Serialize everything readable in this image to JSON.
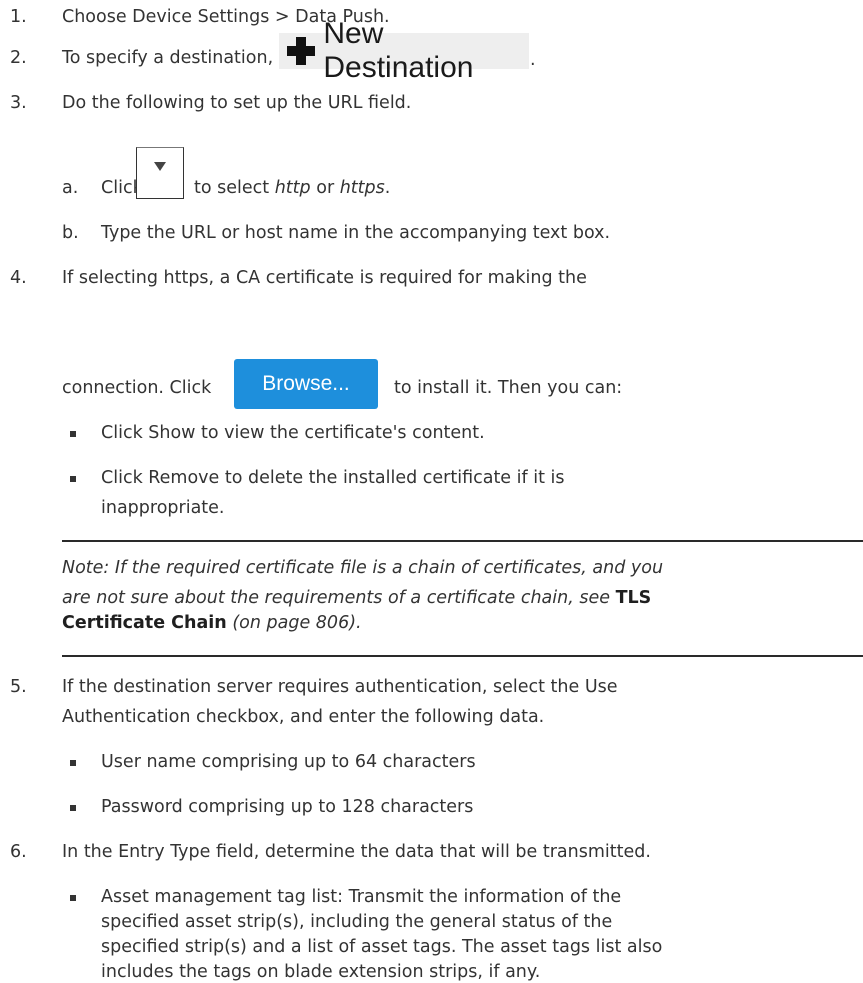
{
  "steps": {
    "s1": {
      "num": "1.",
      "text": "Choose Device Settings > Data Push."
    },
    "s2": {
      "num": "2.",
      "text": "To specify a destination, click",
      "button": "New Destination",
      "suffix": "."
    },
    "s3": {
      "num": "3.",
      "text": "Do the following to set up the URL field.",
      "a": {
        "letter": "a.",
        "pre": "Click",
        "mid": "to select",
        "http": "http",
        "or": "or",
        "https": "https",
        "end": "."
      },
      "b": {
        "letter": "b.",
        "text": "Type the URL or host name in the accompanying text box."
      }
    },
    "s4": {
      "num": "4.",
      "line1": "If selecting https, a CA certificate is required for making the",
      "line2_pre": "connection. Click",
      "browse": "Browse...",
      "line2_post": "to install it. Then you can:",
      "bullets": [
        "Click Show to view the certificate's content.",
        "Click Remove to delete the installed certificate if it is",
        "inappropriate."
      ]
    },
    "note": {
      "line1": "Note: If the required certificate file is a chain of certificates, and you",
      "line2_pre": "are not sure about the requirements of a certificate chain, see",
      "link1": "TLS",
      "link2": "Certificate Chain",
      "page": "(on page 806)."
    },
    "s5": {
      "num": "5.",
      "line1": "If the destination server requires authentication, select the Use",
      "line2": "Authentication checkbox, and enter the following data.",
      "bullets": [
        "User name comprising up to 64 characters",
        "Password comprising up to 128 characters"
      ]
    },
    "s6": {
      "num": "6.",
      "text": "In the Entry Type field, determine the data that will be transmitted.",
      "bullet_lines": [
        "Asset management tag list: Transmit the information of the",
        "specified asset strip(s), including the general status of the",
        "specified strip(s) and a list of asset tags. The asset tags list also",
        "includes the tags on blade extension strips, if any."
      ]
    }
  },
  "icons": {
    "new_destination": "plus-icon",
    "dropdown": "dropdown-arrow-icon"
  },
  "colors": {
    "browse_button": "#1e8fdc",
    "new_destination_bg": "#eeeeee",
    "text": "#333333"
  }
}
